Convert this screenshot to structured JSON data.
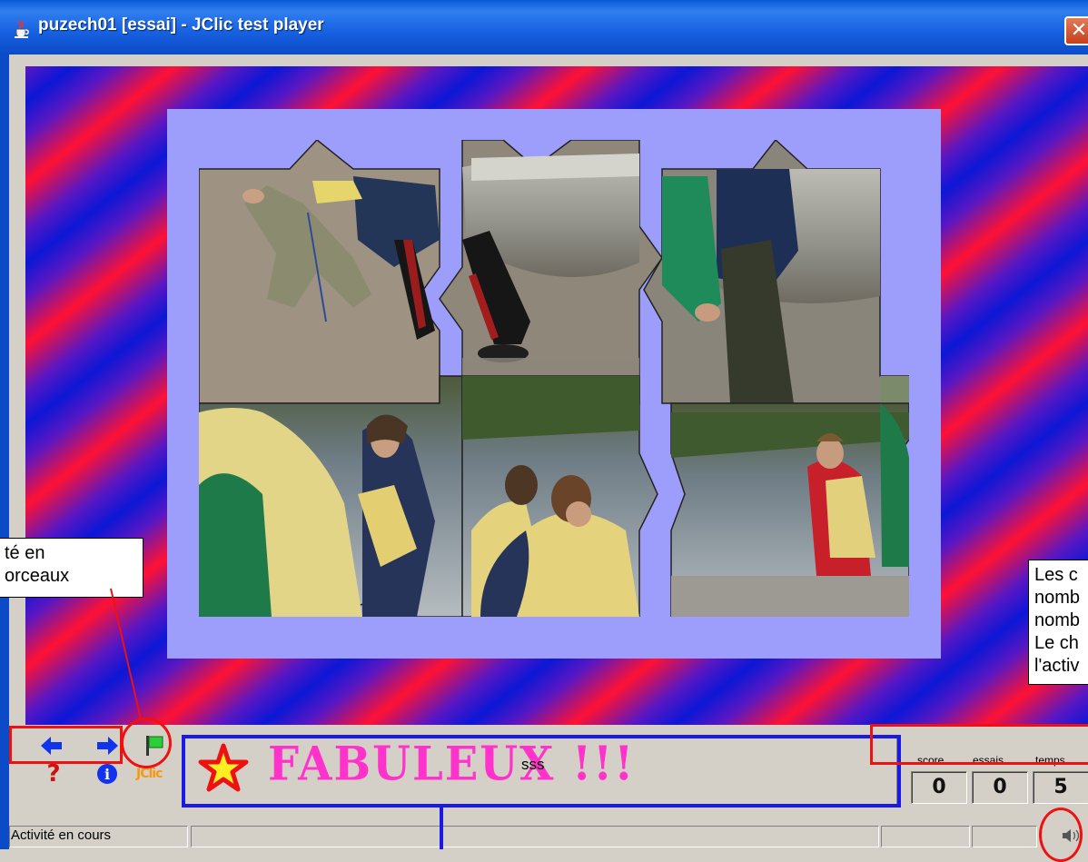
{
  "window": {
    "title": "puzech01 [essai] - JClic test player",
    "close_glyph": "✕"
  },
  "controls": {
    "prev_icon": "arrow-left-icon",
    "next_icon": "arrow-right-icon",
    "help_glyph": "?",
    "info_glyph": "i",
    "flag_icon": "green-flag-icon",
    "jclic_logo": "JClic"
  },
  "message": {
    "title": "FABULEUX !!!",
    "text": "sss",
    "star_icon": "star-icon"
  },
  "counters": [
    {
      "label": "score",
      "value": "0"
    },
    {
      "label": "essais",
      "value": "0"
    },
    {
      "label": "temps",
      "value": "5"
    }
  ],
  "status": {
    "text": "Activité en cours",
    "sound_icon": "speaker-icon"
  },
  "annotations": {
    "left_callout": [
      "té en",
      "orceaux"
    ],
    "right_callout": [
      "Les c",
      "nomb",
      "nomb",
      "Le ch",
      "l'activ"
    ]
  },
  "colors": {
    "title_bar": "#0a5ad6",
    "stripe_red": "#ff1133",
    "stripe_blue": "#0c17d6",
    "panel": "#9d9efc",
    "message_pink": "#ff33cc",
    "annotation_red": "#ee1111",
    "annotation_blue": "#1a1ae6"
  }
}
